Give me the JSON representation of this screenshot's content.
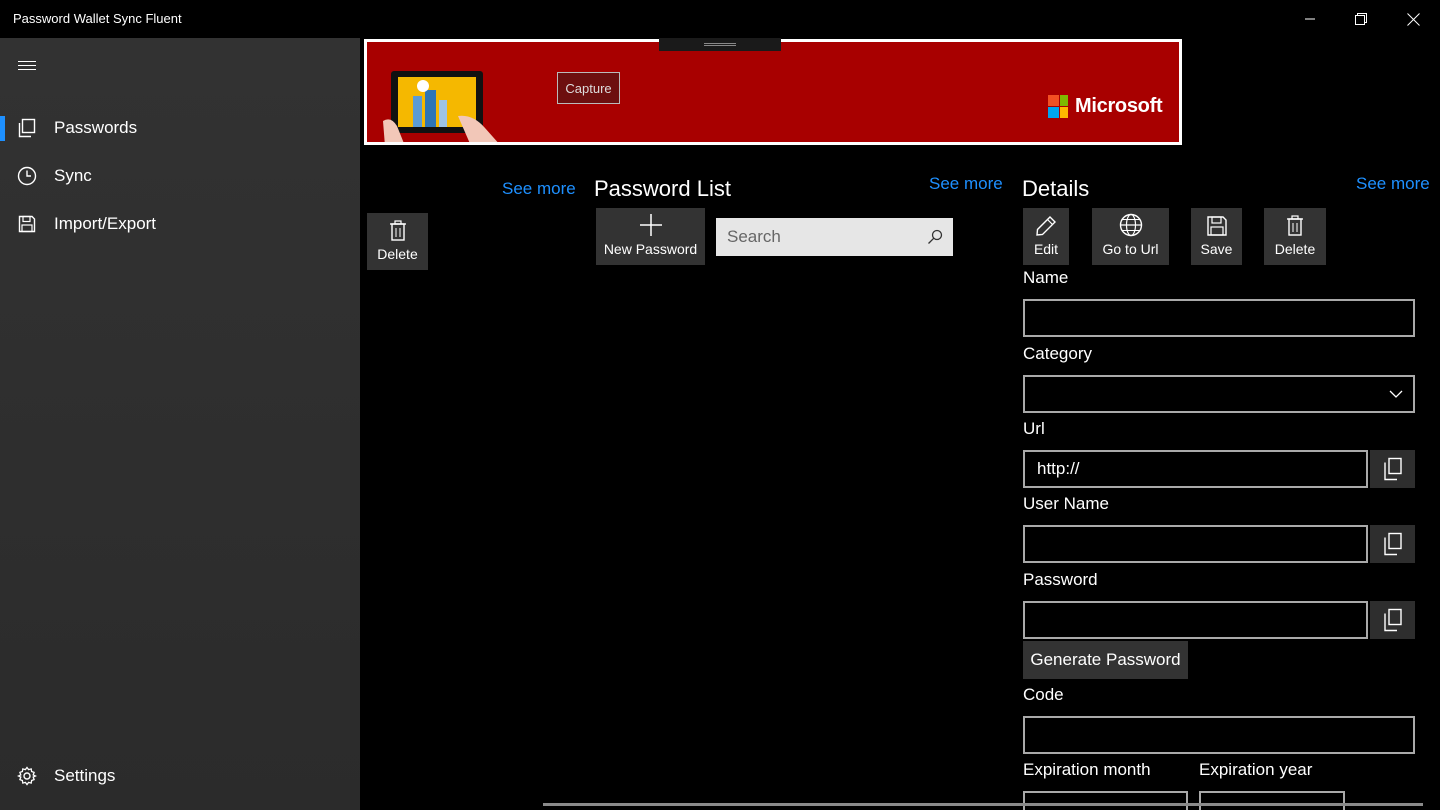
{
  "window": {
    "title": "Password Wallet Sync Fluent",
    "minimize_icon": "minimize-icon",
    "maximize_icon": "restore-icon",
    "close_icon": "close-icon"
  },
  "sidebar": {
    "menu_icon": "hamburger-icon",
    "items": [
      {
        "label": "Passwords",
        "icon": "copy-pages-icon",
        "selected": true
      },
      {
        "label": "Sync",
        "icon": "clock-icon",
        "selected": false
      },
      {
        "label": "Import/Export",
        "icon": "floppy-disk-icon",
        "selected": false
      }
    ],
    "settings": {
      "label": "Settings",
      "icon": "gear-icon"
    }
  },
  "ad": {
    "capture_label": "Capture",
    "brand": "Microsoft",
    "accent": "#a80000"
  },
  "left_column": {
    "see_more": "See more",
    "delete_label": "Delete"
  },
  "password_list": {
    "title": "Password List",
    "see_more": "See more",
    "new_password_label": "New Password",
    "search_placeholder": "Search"
  },
  "details": {
    "title": "Details",
    "see_more": "See more",
    "toolbar": {
      "edit": "Edit",
      "go_to_url": "Go to Url",
      "save": "Save",
      "delete": "Delete"
    },
    "fields": {
      "name_label": "Name",
      "name_value": "",
      "category_label": "Category",
      "category_value": "",
      "url_label": "Url",
      "url_value": "http://",
      "username_label": "User Name",
      "username_value": "",
      "password_label": "Password",
      "password_value": "",
      "generate_password": "Generate Password",
      "code_label": "Code",
      "code_value": "",
      "expiration_month_label": "Expiration month",
      "expiration_year_label": "Expiration year"
    }
  },
  "colors": {
    "accent_blue": "#1e90ff",
    "sidebar_bg": "#2f2f2f",
    "button_bg": "#333333"
  }
}
